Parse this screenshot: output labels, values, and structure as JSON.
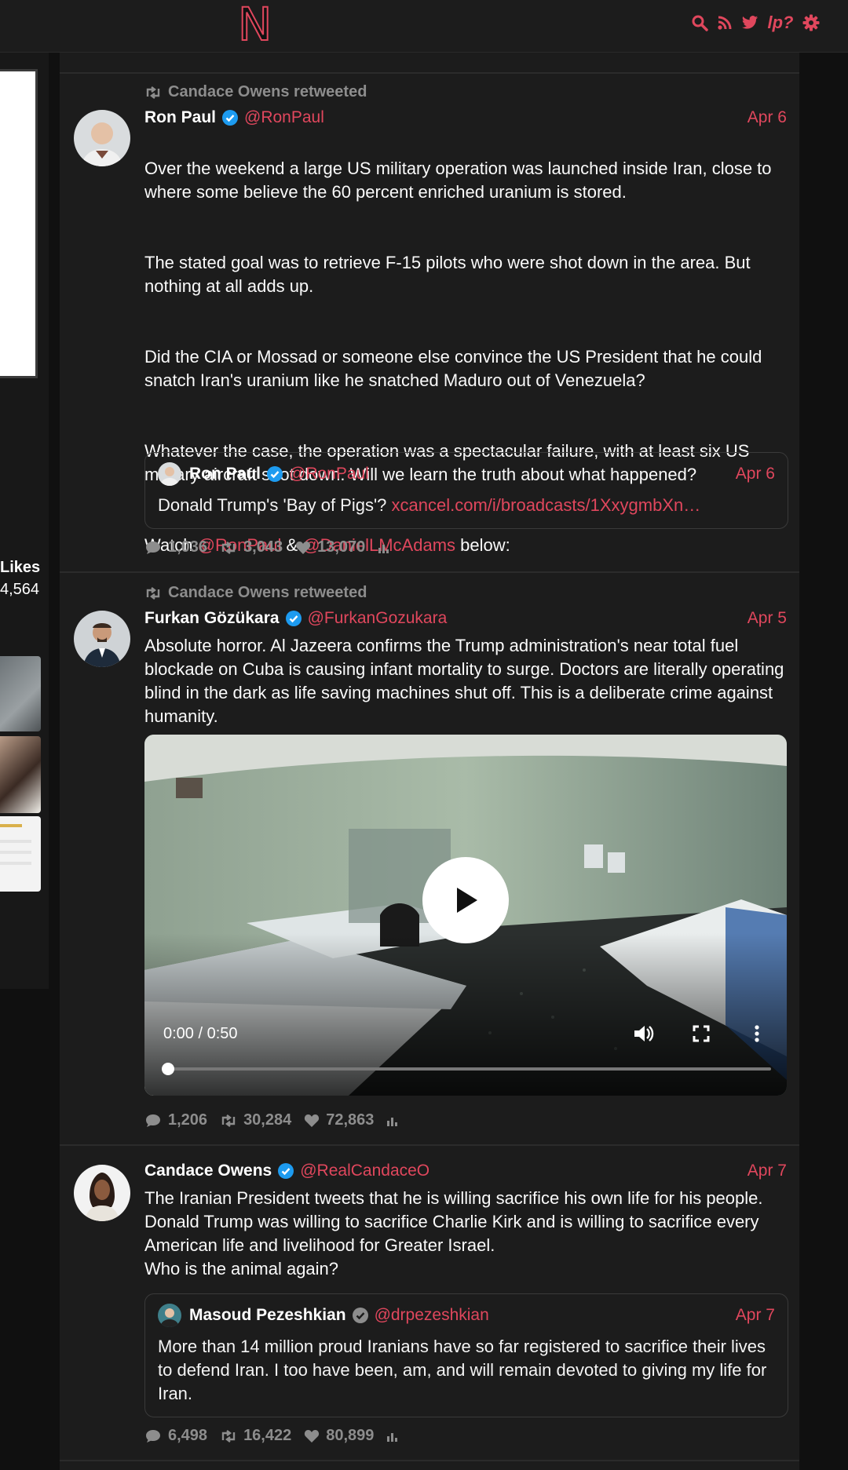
{
  "header": {
    "logo": "N"
  },
  "nav_icons": [
    "search-icon",
    "rss-icon",
    "twitter-icon",
    "lp-question-icon",
    "gear-icon"
  ],
  "nav_text_icon": "lp?",
  "sidebar": {
    "likes_label": "Likes",
    "likes_value": "4,564"
  },
  "colors": {
    "accent": "#e0475d",
    "bg": "#1c1c1c",
    "muted": "#8d8d8d",
    "verified": "#1d9bf0"
  },
  "tweets": [
    {
      "retweeted_by": "Candace Owens retweeted",
      "name": "Ron Paul",
      "handle": "@RonPaul",
      "date": "Apr 6",
      "p1": "Over the weekend a large US military operation was launched inside Iran, close to where some believe the 60 percent enriched uranium is stored.",
      "p2": "The stated goal was to retrieve F-15 pilots who were shot down in the area. But nothing at all adds up.",
      "p3": "Did the CIA or Mossad or someone else convince the US President that he could snatch Iran's uranium like he snatched Maduro out of Venezuela?",
      "p4": "Whatever the case, the operation was a spectacular failure, with at least six US military aircraft shot down. Will we learn the truth about what happened?",
      "watch_prefix": "Watch ",
      "mention1": "@RonPaul",
      "amp": " & ",
      "mention2": "@DanielLMcAdams",
      "watch_suffix": " below:",
      "quote": {
        "name": "Ron Paul",
        "handle": "@RonPaul",
        "date": "Apr 6",
        "text": "Donald Trump's 'Bay of Pigs'? ",
        "link": "xcancel.com/i/broadcasts/1XxygmbXn…"
      },
      "replies": "1,036",
      "retweets": "3,043",
      "likes": "13,070"
    },
    {
      "retweeted_by": "Candace Owens retweeted",
      "name": "Furkan Gözükara",
      "handle": "@FurkanGozukara",
      "date": "Apr 5",
      "text": "Absolute horror. Al Jazeera confirms the Trump administration's near total fuel blockade on Cuba is causing infant mortality to surge. Doctors are literally operating blind in the dark as life saving machines shut off. This is a deliberate crime against humanity.",
      "video_time": "0:00 / 0:50",
      "video_progress": 0,
      "replies": "1,206",
      "retweets": "30,284",
      "likes": "72,863"
    },
    {
      "name": "Candace Owens",
      "handle": "@RealCandaceO",
      "date": "Apr 7",
      "text": "The Iranian President tweets that he is willing sacrifice his own life for his people. Donald Trump was willing to sacrifice Charlie Kirk and is willing to sacrifice every American life and livelihood for Greater Israel.\nWho is the animal again?",
      "quote": {
        "name": "Masoud Pezeshkian",
        "handle": "@drpezeshkian",
        "date": "Apr 7",
        "text": "More than 14 million proud Iranians have so far registered to sacrifice their lives to defend Iran. I too have been, am, and will remain devoted to giving my life for Iran."
      },
      "replies": "6,498",
      "retweets": "16,422",
      "likes": "80,899"
    }
  ]
}
